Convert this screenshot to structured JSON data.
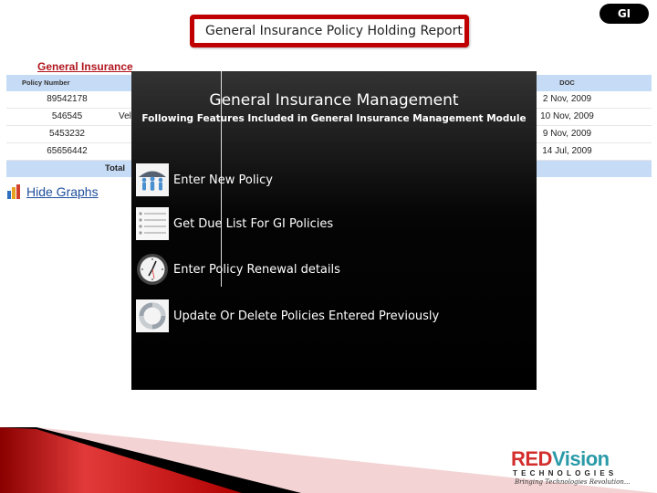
{
  "slide": {
    "title": "General Insurance Policy Holding Report",
    "badge": "GI"
  },
  "report": {
    "heading": "General Insurance",
    "columns": {
      "policy_number": "Policy Number",
      "doc": "DOC"
    },
    "rows": [
      {
        "policy_number": "89542178",
        "middle": "",
        "doc": "2 Nov, 2009"
      },
      {
        "policy_number": "546545",
        "middle": "Vel",
        "doc": "10 Nov, 2009"
      },
      {
        "policy_number": "5453232",
        "middle": "",
        "doc": "9 Nov, 2009"
      },
      {
        "policy_number": "65656442",
        "middle": "",
        "doc": "14 Jul, 2009"
      }
    ],
    "total_label": "Total",
    "hide_graphs_label": "Hide Graphs"
  },
  "overlay": {
    "title": "General Insurance Management",
    "subtitle": "Following Features Included in General Insurance Management Module",
    "features": [
      {
        "label": "Enter New Policy",
        "icon": "umbrella-people-icon"
      },
      {
        "label": "Get Due List For GI Policies",
        "icon": "list-icon"
      },
      {
        "label": "Enter Policy Renewal details",
        "icon": "clock-icon"
      },
      {
        "label": "Update Or Delete Policies Entered Previously",
        "icon": "refresh-icon"
      }
    ]
  },
  "logo": {
    "brand_red": "RED",
    "brand_teal": "Vision",
    "subtitle": "TECHNOLOGIES",
    "tagline": "Bringing Technologies Revolution..."
  },
  "colors": {
    "accent_red": "#c00000",
    "table_header": "#c6dbf5",
    "heading_red": "#b0151e",
    "link_blue": "#1f4e9c"
  }
}
